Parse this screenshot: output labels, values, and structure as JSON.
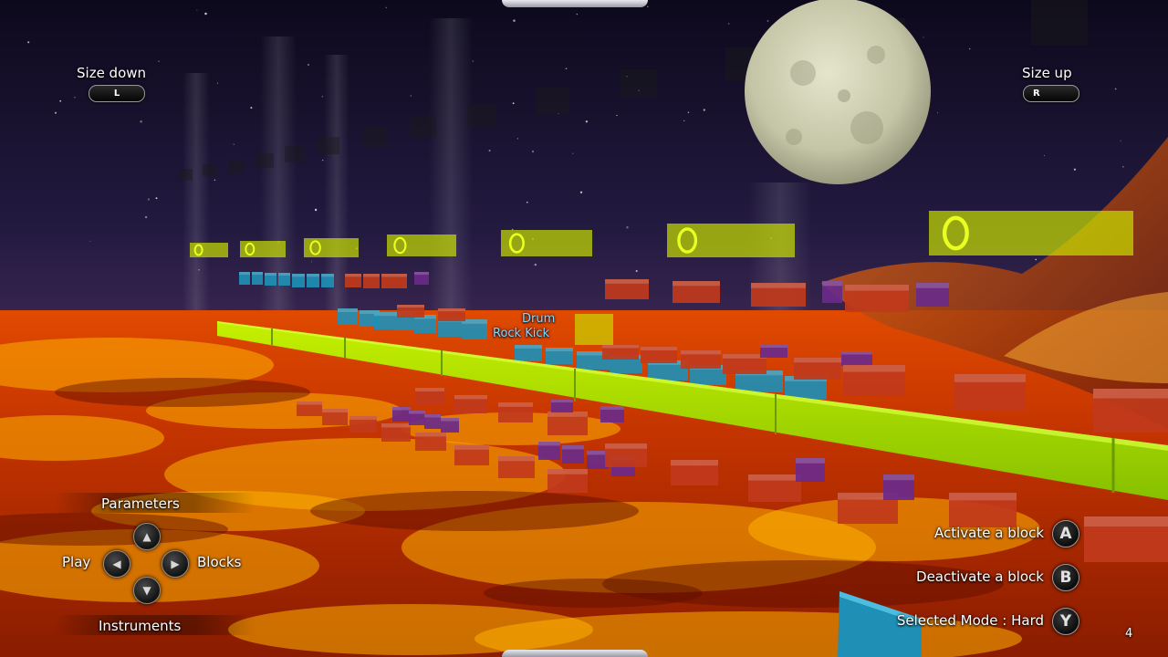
{
  "hud": {
    "size_down": {
      "label": "Size down",
      "key": "L"
    },
    "size_up": {
      "label": "Size up",
      "key": "R"
    },
    "dpad": {
      "up_label": "Parameters",
      "left_label": "Play",
      "right_label": "Blocks",
      "down_label": "Instruments",
      "up_icon": "arrow-up-icon",
      "left_icon": "arrow-left-icon",
      "right_icon": "arrow-right-icon",
      "down_icon": "arrow-down-icon"
    },
    "actions": [
      {
        "label": "Activate a block",
        "button": "A"
      },
      {
        "label": "Deactivate a block",
        "button": "B"
      },
      {
        "label": "Selected Mode : Hard",
        "button": "Y"
      }
    ],
    "counter": "4"
  },
  "scene": {
    "instrument_type": "Drum",
    "instrument_name": "Rock Kick",
    "colors": {
      "sky_top": "#0e0a1e",
      "sky_bottom": "#2a1e4a",
      "lava_dark": "#b02a00",
      "lava_bright": "#ffb300",
      "rail_green": "#9bd700",
      "marker_yellow": "#c9e000",
      "block_red": "#c0391b",
      "block_blue": "#1f8fb5",
      "block_purple": "#6a2a8a",
      "moon": "#cfd0b4"
    }
  }
}
